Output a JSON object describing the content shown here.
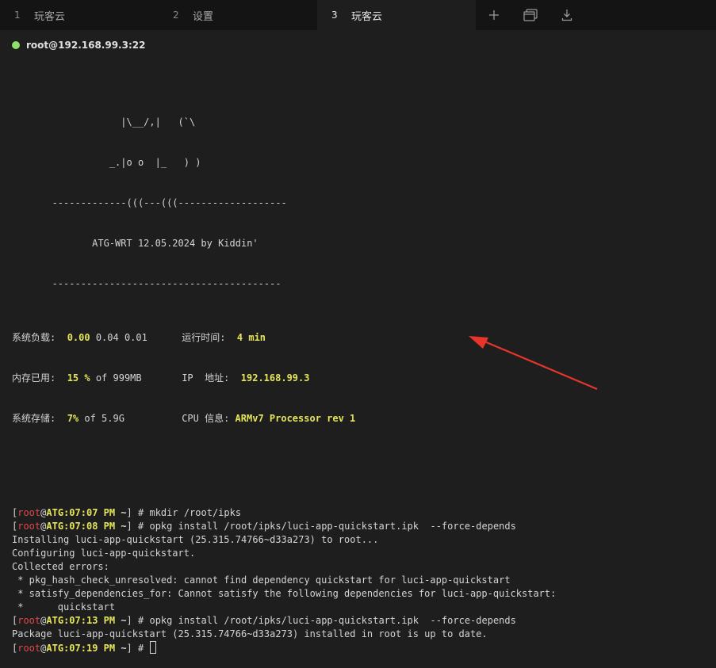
{
  "tabs": [
    {
      "num": "1",
      "label": "玩客云"
    },
    {
      "num": "2",
      "label": "设置"
    },
    {
      "num": "3",
      "label": "玩客云"
    }
  ],
  "tab_actions": [
    "plus-icon",
    "split-window-icon",
    "download-icon"
  ],
  "session": {
    "host": "root@192.168.99.3:22",
    "status_color": "#8ee06a"
  },
  "banner": {
    "art1": "                   |\\__/,|   (`\\",
    "art2": "                 _.|o o  |_   ) )",
    "art3": "       -------------(((---(((-------------------",
    "title": "              ATG-WRT 12.05.2024 by Kiddin'",
    "sep": "       ----------------------------------------"
  },
  "sysinfo": {
    "load_label": "系统负载:",
    "load1": "0.00",
    "load_rest": " 0.04 0.01",
    "uptime_label": "运行时间:",
    "uptime": "4 min",
    "mem_label": "内存已用:",
    "mem_pct": "15 %",
    "mem_rest": " of 999MB",
    "ip_label": "IP  地址:",
    "ip": "192.168.99.3",
    "disk_label": "系统存储:",
    "disk_pct": "7%",
    "disk_rest": " of 5.9G",
    "cpu_label": "CPU 信息:",
    "cpu": "ARMv7 Processor rev 1"
  },
  "prompt": {
    "open": "[",
    "user": "root",
    "at": "@",
    "host": "ATG",
    "colon": ":",
    "close": "]",
    "sep": " ~",
    "sym": " # "
  },
  "lines": [
    {
      "type": "cmd",
      "time": "07:07 PM",
      "cmd": "mkdir /root/ipks"
    },
    {
      "type": "cmd",
      "time": "07:08 PM",
      "cmd": "opkg install /root/ipks/luci-app-quickstart.ipk  --force-depends"
    },
    {
      "type": "out",
      "text": "Installing luci-app-quickstart (25.315.74766~d33a273) to root..."
    },
    {
      "type": "out",
      "text": "Configuring luci-app-quickstart."
    },
    {
      "type": "out",
      "text": "Collected errors:"
    },
    {
      "type": "out",
      "text": " * pkg_hash_check_unresolved: cannot find dependency quickstart for luci-app-quickstart"
    },
    {
      "type": "out",
      "text": " * satisfy_dependencies_for: Cannot satisfy the following dependencies for luci-app-quickstart:"
    },
    {
      "type": "out",
      "text": " *      quickstart"
    },
    {
      "type": "cmd",
      "time": "07:13 PM",
      "cmd": "opkg install /root/ipks/luci-app-quickstart.ipk  --force-depends"
    },
    {
      "type": "out",
      "text": "Package luci-app-quickstart (25.315.74766~d33a273) installed in root is up to date."
    },
    {
      "type": "cmd",
      "time": "07:19 PM",
      "cmd": "",
      "cursor": true
    }
  ],
  "colors": {
    "background": "#1e1e1e",
    "tabbar": "#141414",
    "highlight": "#e5e55a",
    "prompt_user": "#e04848",
    "annotation_arrow": "#e8352b"
  }
}
